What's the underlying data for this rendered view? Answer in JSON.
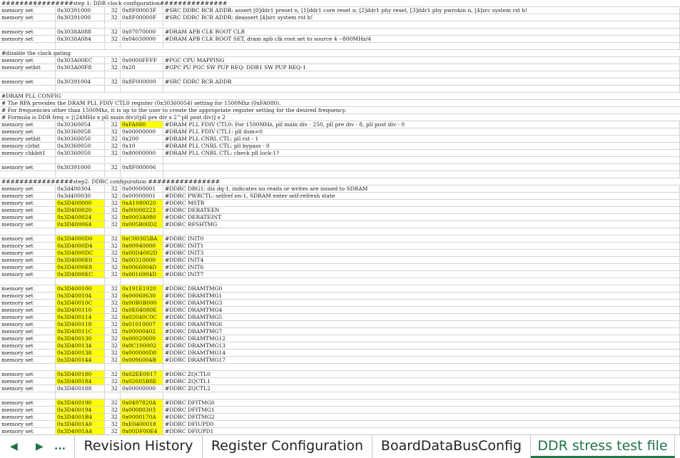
{
  "sheet_rows": [
    {
      "a": "################step 1: DDR clock configuration###############",
      "b": "",
      "c": "",
      "d": "",
      "e": ""
    },
    {
      "a": "memory set",
      "b": "0x30391000",
      "c": "32",
      "d": "0x8F00003F",
      "e": "#SRC DDRC RCR ADDR: assert [0]ddr1 preset n, [1]ddr1 core reset n, [2]ddr1 phy reset, [3]ddr1 phy pwrokin n, [4]src system rst b!"
    },
    {
      "a": "memory set",
      "b": "0x30391000",
      "c": "32",
      "d": "0x8F00000F",
      "e": "#SRC DDRC RCR ADDR: deassert [4]src system rst b!"
    },
    {
      "a": "",
      "b": "",
      "c": "",
      "d": "",
      "e": ""
    },
    {
      "a": "memory set",
      "b": "0x3038A088",
      "c": "32",
      "d": "0x07070000",
      "e": "#DRAM APB CLK ROOT CLR"
    },
    {
      "a": "memory set",
      "b": "0x3038A084",
      "c": "32",
      "d": "0x04030000",
      "e": "#DRAM APB CLK ROOT SET, dram apb clk root set to source 4 --800MHz/4"
    },
    {
      "a": "",
      "b": "",
      "c": "",
      "d": "",
      "e": ""
    },
    {
      "a": "#disable the clock gating",
      "b": "",
      "c": "",
      "d": "",
      "e": ""
    },
    {
      "a": "memory set",
      "b": "0x303A00EC",
      "c": "32",
      "d": "0x0000FFFF",
      "e": "#PGC CPU MAPPING"
    },
    {
      "a": "memory setbit",
      "b": "0x303A00F8",
      "c": "32",
      "d": "0x20",
      "e": "#GPC PU PGC SW PUP REQ: DDR1 SW PUP REQ-1"
    },
    {
      "a": "",
      "b": "",
      "c": "",
      "d": "",
      "e": ""
    },
    {
      "a": "memory set",
      "b": "0x30391004",
      "c": "32",
      "d": "0x8F000000",
      "e": "#SRC DDRC RCR ADDR"
    },
    {
      "a": "",
      "b": "",
      "c": "",
      "d": "",
      "e": ""
    },
    {
      "a": "#DRAM PLL CONFIG",
      "b": "",
      "c": "",
      "d": "",
      "e": ""
    },
    {
      "a": "# The RPA provides the DRAM PLL FDIV CTL0 register (0x30360054) setting for 1500Mhz (0xFA080).",
      "b": "",
      "c": "",
      "d": "",
      "e": ""
    },
    {
      "a": "# For frequencies other than 1500Mhz, it is up to the user to create the appropriate register setting for the desired frequency.",
      "b": "",
      "c": "",
      "d": "",
      "e": ""
    },
    {
      "a": "# Formula is DDR freq = [(24MHz x pll main div)/(pll pre div x 2^pll post div)] x 2",
      "b": "",
      "c": "",
      "d": "",
      "e": ""
    },
    {
      "a": "memory set",
      "b": "0x30360054",
      "c": "32",
      "d": "0xFA080",
      "e": "#DRAM PLL FDIV CTL0: For 1500MHz, pll main div - 250, pll pre div - 8, pll post div - 0",
      "hd": true
    },
    {
      "a": "memory set",
      "b": "0x30360058",
      "c": "32",
      "d": "0x00000000",
      "e": "#DRAM PLL FDIV CTL1: pll dsm=0"
    },
    {
      "a": "memory setbit",
      "b": "0x30360050",
      "c": "32",
      "d": "0x200",
      "e": "#DRAM PLL CNRL CTL: pll rst - 1"
    },
    {
      "a": "memory clrbit",
      "b": "0x30360050",
      "c": "32",
      "d": "0x10",
      "e": "#DRAM PLL CNRL CTL: pll bypass - 0"
    },
    {
      "a": "memory chkbit1",
      "b": "0x30360050",
      "c": "32",
      "d": "0x80000000",
      "e": "#DRAM PLL CNRL CTL: check pll lock-1?"
    },
    {
      "a": "",
      "b": "",
      "c": "",
      "d": "",
      "e": ""
    },
    {
      "a": "memory set",
      "b": "0x30391000",
      "c": "32",
      "d": "0x8F000006",
      "e": ""
    },
    {
      "a": "",
      "b": "",
      "c": "",
      "d": "",
      "e": ""
    },
    {
      "a": "################step2: DDRC configuration ################",
      "b": "",
      "c": "",
      "d": "",
      "e": ""
    },
    {
      "a": "memory set",
      "b": "0x3d400304",
      "c": "32",
      "d": "0x00000001",
      "e": "#DDRC DBG1: dis dq-1, indicates no reads or writes are issued to SDRAM"
    },
    {
      "a": "memory set",
      "b": "0x3d400030",
      "c": "32",
      "d": "0x00000001",
      "e": "#DDRC PWRCTL: selfref en-1, SDRAM enter self-refresh state"
    },
    {
      "a": "memory set",
      "b": "0x3D400000",
      "c": "32",
      "d": "0xA1080020",
      "e": "#DDRC MSTR",
      "hb": true,
      "hd": true
    },
    {
      "a": "memory set",
      "b": "0x3D400020",
      "c": "32",
      "d": "0x00000223",
      "e": "#DDRC DERATEEN",
      "hb": true,
      "hd": true
    },
    {
      "a": "memory set",
      "b": "0x3D400024",
      "c": "32",
      "d": "0x0003A980",
      "e": "#DDRC DERATEINT",
      "hb": true,
      "hd": true
    },
    {
      "a": "memory set",
      "b": "0x3D400064",
      "c": "32",
      "d": "0x005B00D2",
      "e": "#DDRC RFSHTMG",
      "hb": true,
      "hd": true
    },
    {
      "a": "",
      "b": "",
      "c": "",
      "d": "",
      "e": ""
    },
    {
      "a": "memory set",
      "b": "0x3D4000D0",
      "c": "32",
      "d": "0xC00305BA",
      "e": "#DDRC INIT0",
      "hb": true,
      "hd": true
    },
    {
      "a": "memory set",
      "b": "0x3D4000D4",
      "c": "32",
      "d": "0x00940000",
      "e": "#DDRC INIT1",
      "hb": true,
      "hd": true
    },
    {
      "a": "memory set",
      "b": "0x3D4000DC",
      "c": "32",
      "d": "0x00D4002D",
      "e": "#DDRC INIT3",
      "hb": true,
      "hd": true
    },
    {
      "a": "memory set",
      "b": "0x3D4000E0",
      "c": "32",
      "d": "0x00310000",
      "e": "#DDRC INIT4",
      "hb": true,
      "hd": true
    },
    {
      "a": "memory set",
      "b": "0x3D4000E8",
      "c": "32",
      "d": "0x0066004D",
      "e": "#DDRC INIT6",
      "hb": true,
      "hd": true
    },
    {
      "a": "memory set",
      "b": "0x3D4000EC",
      "c": "32",
      "d": "0x0016004D",
      "e": "#DDRC INIT7",
      "hb": true,
      "hd": true
    },
    {
      "a": "",
      "b": "",
      "c": "",
      "d": "",
      "e": ""
    },
    {
      "a": "memory set",
      "b": "0x3D400100",
      "c": "32",
      "d": "0x191E1920",
      "e": "#DDRC DRAMTMG0",
      "hb": true,
      "hd": true
    },
    {
      "a": "memory set",
      "b": "0x3D400104",
      "c": "32",
      "d": "0x00060630",
      "e": "#DDRC DRAMTMG1",
      "hb": true,
      "hd": true
    },
    {
      "a": "memory set",
      "b": "0x3D40010C",
      "c": "32",
      "d": "0x00B0B000",
      "e": "#DDRC DRAMTMG3",
      "hb": true,
      "hd": true
    },
    {
      "a": "memory set",
      "b": "0x3D400110",
      "c": "32",
      "d": "0x0E04080E",
      "e": "#DDRC DRAMTMG4",
      "hb": true,
      "hd": true
    },
    {
      "a": "memory set",
      "b": "0x3D400114",
      "c": "32",
      "d": "0x02040C0C",
      "e": "#DDRC DRAMTMG5",
      "hb": true,
      "hd": true
    },
    {
      "a": "memory set",
      "b": "0x3D400118",
      "c": "32",
      "d": "0x01010007",
      "e": "#DDRC DRAMTMG6",
      "hb": true,
      "hd": true
    },
    {
      "a": "memory set",
      "b": "0x3D40011C",
      "c": "32",
      "d": "0x00000402",
      "e": "#DDRC DRAMTMG7",
      "hb": true,
      "hd": true
    },
    {
      "a": "memory set",
      "b": "0x3D400130",
      "c": "32",
      "d": "0x00020600",
      "e": "#DDRC DRAMTMG12",
      "hb": true,
      "hd": true
    },
    {
      "a": "memory set",
      "b": "0x3D400134",
      "c": "32",
      "d": "0x0C100002",
      "e": "#DDRC DRAMTMG13",
      "hb": true,
      "hd": true
    },
    {
      "a": "memory set",
      "b": "0x3D400138",
      "c": "32",
      "d": "0x000000D8",
      "e": "#DDRC DRAMTMG14",
      "hb": true,
      "hd": true
    },
    {
      "a": "memory set",
      "b": "0x3D400144",
      "c": "32",
      "d": "0x0096004B",
      "e": "#DDRC DRAMTMG17",
      "hb": true,
      "hd": true
    },
    {
      "a": "",
      "b": "",
      "c": "",
      "d": "",
      "e": ""
    },
    {
      "a": "memory set",
      "b": "0x3D400180",
      "c": "32",
      "d": "0x02EE0017",
      "e": "#DDRC ZQCTL0",
      "hb": true,
      "hd": true
    },
    {
      "a": "memory set",
      "b": "0x3D400184",
      "c": "32",
      "d": "0x02605B8E",
      "e": "#DDRC ZQCTL1",
      "hb": true,
      "hd": true
    },
    {
      "a": "memory set",
      "b": "0x3D400188",
      "c": "32",
      "d": "0x00000000",
      "e": "#DDRC ZQCTL2"
    },
    {
      "a": "",
      "b": "",
      "c": "",
      "d": "",
      "e": ""
    },
    {
      "a": "memory set",
      "b": "0x3D400190",
      "c": "32",
      "d": "0x0497820A",
      "e": "#DDRC DFITMG0",
      "hb": true,
      "hd": true
    },
    {
      "a": "memory set",
      "b": "0x3D400194",
      "c": "32",
      "d": "0x00080303",
      "e": "#DDRC DFITMG1",
      "hb": true,
      "hd": true
    },
    {
      "a": "memory set",
      "b": "0x3D4001B4",
      "c": "32",
      "d": "0x0000170A",
      "e": "#DDRC DFITMG2",
      "hb": true,
      "hd": true
    },
    {
      "a": "memory set",
      "b": "0x3D4001A0",
      "c": "32",
      "d": "0xE0400018",
      "e": "#DDRC DFIUPD0",
      "hb": true,
      "hd": true
    },
    {
      "a": "memory set",
      "b": "0x3D4001A4",
      "c": "32",
      "d": "0x00DF00E4",
      "e": "#DDRC DFIUPD1",
      "hb": true,
      "hd": true
    }
  ],
  "tabs": {
    "nav_prev": "◀",
    "nav_next": "▶",
    "nav_more": "...",
    "revision_history": "Revision History",
    "register_configuration": "Register Configuration",
    "board_data_bus_config": "BoardDataBusConfig",
    "ddr_stress_test_file": "DDR stress test file"
  },
  "colors": {
    "highlight": "#ffff00",
    "active_tab": "#217346",
    "grid_line": "#d4d4d4"
  }
}
